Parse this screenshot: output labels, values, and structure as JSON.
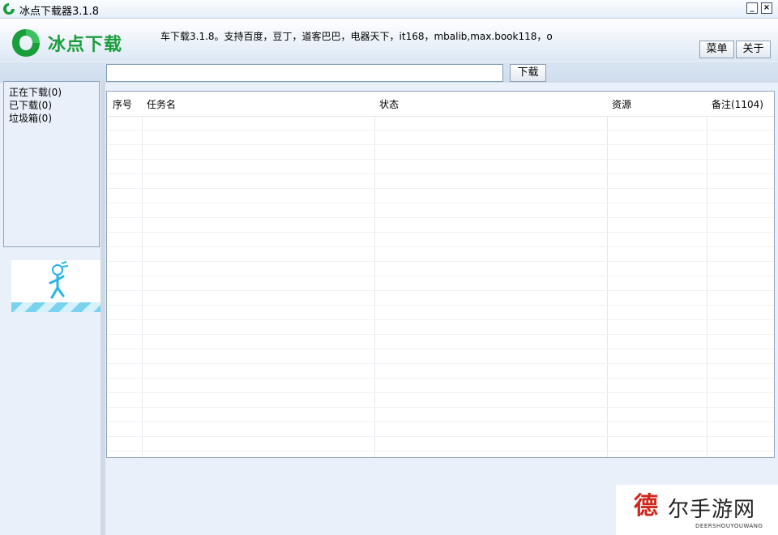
{
  "window": {
    "title": "冰点下载器3.1.8",
    "minimize_label": "_",
    "close_label": "×"
  },
  "header": {
    "logo_text": "冰点下载",
    "marquee": "车下载3.1.8。支持百度，豆丁，道客巴巴，电器天下，it168，mbalib,max.book118，o",
    "menu_label": "菜单",
    "about_label": "关于"
  },
  "toolbar": {
    "url_value": "",
    "download_label": "下载"
  },
  "sidebar": {
    "items": [
      {
        "label": "正在下载(0)"
      },
      {
        "label": "已下载(0)"
      },
      {
        "label": "垃圾箱(0)"
      }
    ]
  },
  "table": {
    "columns": [
      "序号",
      "任务名",
      "状态",
      "资源",
      "备注(1104)"
    ],
    "rows": []
  },
  "watermark": {
    "char": "德",
    "text": "尔手游网",
    "sub": "DEERSHOUYOUWANG"
  },
  "colors": {
    "brand_green": "#1a9e3c",
    "frame_blue": "#e9f0f9",
    "border": "#8ea3bd"
  }
}
